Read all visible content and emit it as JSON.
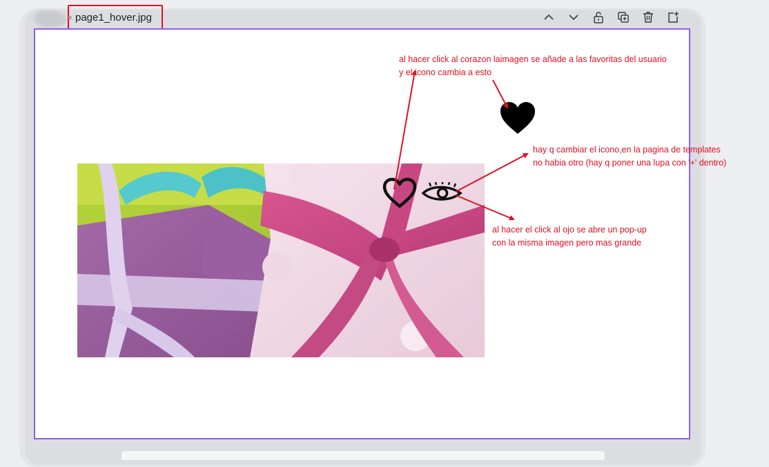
{
  "window": {
    "title": "page1_hover.jpg"
  },
  "toolbar": {
    "buttons": [
      {
        "name": "move-up-button",
        "icon": "chevron-up-icon"
      },
      {
        "name": "move-down-button",
        "icon": "chevron-down-icon"
      },
      {
        "name": "lock-button",
        "icon": "lock-icon"
      },
      {
        "name": "duplicate-button",
        "icon": "duplicate-icon"
      },
      {
        "name": "delete-button",
        "icon": "trash-icon"
      },
      {
        "name": "add-page-button",
        "icon": "add-page-icon"
      }
    ]
  },
  "annotations": {
    "heart_note": [
      "al hacer click al corazon laimagen se añade a las favoritas del usuario",
      "y el icono cambia a esto"
    ],
    "icon_note": [
      "hay q cambiar el icono,en la pagina de templates",
      "no habia otro (hay q poner una lupa con '+' dentro)"
    ],
    "eye_note": [
      "al hacer el click al ojo se abre un pop-up",
      "con la misma imagen pero mas grande"
    ]
  },
  "colors": {
    "annotation": "#e01020",
    "canvas_border": "#8b5cf6",
    "frame": "#e4e5e7"
  },
  "icons": {
    "favorite_outline": "heart-outline-icon",
    "favorite_filled": "heart-filled-icon",
    "preview": "eye-icon"
  }
}
